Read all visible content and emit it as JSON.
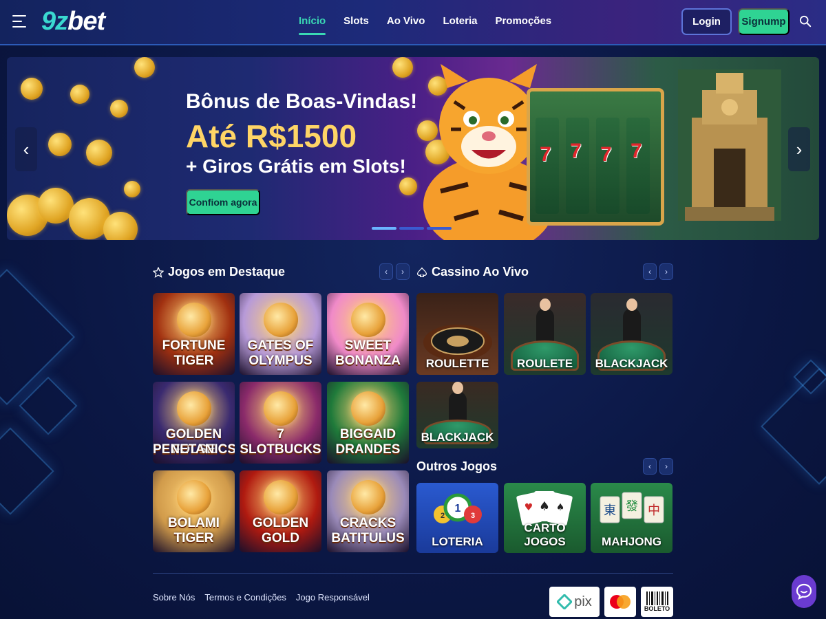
{
  "header": {
    "logo_prefix": "9z",
    "logo_suffix": "bet",
    "nav": [
      "Início",
      "Slots",
      "Ao Vivo",
      "Loteria",
      "Promoções"
    ],
    "login_label": "Login",
    "signup_label": "Signump"
  },
  "banner": {
    "title": "Bônus de Boas-Vindas!",
    "amount": "Até R$1500",
    "subtitle": "+ Giros Grátis em Slots!",
    "cta": "Confiom agora",
    "slide_count": 3,
    "active_slide": 1
  },
  "featured": {
    "title": "Jogos em Destaque",
    "games": [
      {
        "label": "FORTUNE TIGER",
        "line1": "FORTUNE",
        "line2": "TIGER",
        "bg": "#a13010"
      },
      {
        "label": "GATES OF OLYMPUS",
        "line1": "GATES OF",
        "line2": "OLYMPUS",
        "bg": "#b79ad8"
      },
      {
        "label": "SWEET BONANZA",
        "line1": "SWEET",
        "line2": "BONANZA",
        "bg": "#f08ac8"
      },
      {
        "label": "GOLDEN FOLSE PENETANICS",
        "line1": "GOLDEN FOLSE",
        "line2": "PENETANICS",
        "bg": "#3a2a70"
      },
      {
        "label": "SLOTBUCKS",
        "line1": "7",
        "line2": "SLOTBUCKS",
        "bg": "#8a2a6a"
      },
      {
        "label": "BIGGAID DRANDES",
        "line1": "BIGGAID",
        "line2": "DRANDES",
        "bg": "#1f7a3a"
      },
      {
        "label": "BOLAMI TIGER",
        "line1": "BOLAMI",
        "line2": "TIGER",
        "bg": "#d09a4a"
      },
      {
        "label": "GOLDEN GOLD",
        "line1": "GOLDEN",
        "line2": "GOLD",
        "bg": "#b01a10"
      },
      {
        "label": "CRACKS BATITULUS",
        "line1": "CRACKS",
        "line2": "BATITULUS",
        "bg": "#9a8ab8"
      }
    ]
  },
  "live": {
    "title": "Cassino Ao Vivo",
    "games": [
      "ROULETTE",
      "ROULETE",
      "BLACKJACK",
      "BLACKJACK"
    ]
  },
  "others": {
    "title": "Outros Jogos",
    "games": [
      "LOTERIA",
      "CARTO JOGOS",
      "MAHJONG"
    ]
  },
  "footer": {
    "links": [
      "Sobre Nós",
      "Termos e Condições",
      "Jogo Responsável"
    ],
    "payments": [
      "pix",
      "mastercard",
      "BOLETO"
    ]
  },
  "colors": {
    "accent": "#2fd393",
    "brand": "#3ad8d0",
    "bg": "#0b1744"
  }
}
